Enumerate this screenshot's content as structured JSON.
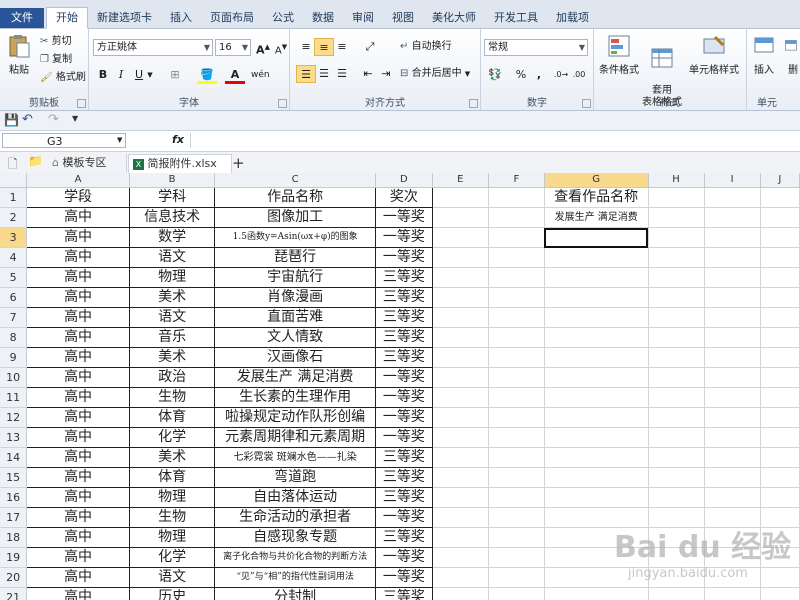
{
  "ribbon_tabs": [
    "文件",
    "开始",
    "新建选项卡",
    "插入",
    "页面布局",
    "公式",
    "数据",
    "审阅",
    "视图",
    "美化大师",
    "开发工具",
    "加载项"
  ],
  "clipboard": {
    "paste": "粘贴",
    "cut": "剪切",
    "copy": "复制",
    "format_painter": "格式刷",
    "group": "剪贴板"
  },
  "font": {
    "name": "方正姚体",
    "size": "16",
    "bold": "B",
    "italic": "I",
    "underline": "U",
    "wen": "wén",
    "group": "字体"
  },
  "alignment": {
    "wrap": "自动换行",
    "merge": "合并后居中",
    "group": "对齐方式"
  },
  "number": {
    "format": "常规",
    "percent": "%",
    "comma": ",",
    "group": "数字"
  },
  "styles": {
    "conditional": "条件格式",
    "table_format": "套用\n表格格式",
    "cell_style": "单元格样式",
    "group": "样式"
  },
  "cells": {
    "insert": "插入",
    "delete": "删",
    "group": "单元"
  },
  "name_box": "G3",
  "fx": "fx",
  "doc_tabs": {
    "template": "模板专区",
    "file": "简报附件.xlsx",
    "add": "+"
  },
  "columns": [
    "A",
    "B",
    "C",
    "D",
    "E",
    "F",
    "G",
    "H",
    "I",
    "J"
  ],
  "rows": [
    [
      "学段",
      "学科",
      "作品名称",
      "奖次"
    ],
    [
      "高中",
      "信息技术",
      "图像加工",
      "一等奖"
    ],
    [
      "高中",
      "数学",
      "1.5函数y=Asin(ωx+φ)的图象",
      "一等奖"
    ],
    [
      "高中",
      "语文",
      "琵琶行",
      "一等奖"
    ],
    [
      "高中",
      "物理",
      "宇宙航行",
      "三等奖"
    ],
    [
      "高中",
      "美术",
      "肖像漫画",
      "三等奖"
    ],
    [
      "高中",
      "语文",
      "直面苦难",
      "三等奖"
    ],
    [
      "高中",
      "音乐",
      "文人情致",
      "三等奖"
    ],
    [
      "高中",
      "美术",
      "汉画像石",
      "三等奖"
    ],
    [
      "高中",
      "政治",
      "发展生产 满足消费",
      "一等奖"
    ],
    [
      "高中",
      "生物",
      "生长素的生理作用",
      "一等奖"
    ],
    [
      "高中",
      "体育",
      "啦操规定动作队形创编",
      "一等奖"
    ],
    [
      "高中",
      "化学",
      "元素周期律和元素周期",
      "一等奖"
    ],
    [
      "高中",
      "美术",
      "七彩霓裳 斑斓水色——扎染",
      "三等奖"
    ],
    [
      "高中",
      "体育",
      "弯道跑",
      "三等奖"
    ],
    [
      "高中",
      "物理",
      "自由落体运动",
      "三等奖"
    ],
    [
      "高中",
      "生物",
      "生命活动的承担者",
      "一等奖"
    ],
    [
      "高中",
      "物理",
      "自感现象专题",
      "三等奖"
    ],
    [
      "高中",
      "化学",
      "离子化合物与共价化合物的判断方法",
      "一等奖"
    ],
    [
      "高中",
      "语文",
      "“见”与“相”的指代性副词用法",
      "一等奖"
    ],
    [
      "高中",
      "历史",
      "分封制",
      "三等奖"
    ]
  ],
  "lookup": {
    "title": "查看作品名称",
    "value": "发展生产 满足消费"
  },
  "watermark": {
    "brand": "Bai du 经验",
    "url": "jingyan.baidu.com"
  }
}
